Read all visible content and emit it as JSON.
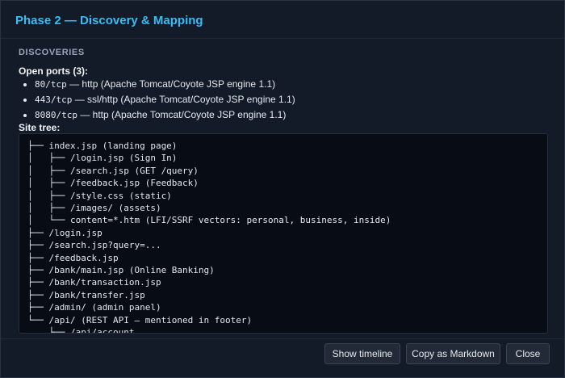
{
  "dialog": {
    "title": "Phase 2 — Discovery & Mapping"
  },
  "discoveries": {
    "section_label": "DISCOVERIES",
    "open_ports_heading": "Open ports (3):",
    "ports": [
      {
        "port": "80/tcp",
        "desc": " — http (Apache Tomcat/Coyote JSP engine 1.1)"
      },
      {
        "port": "443/tcp",
        "desc": " — ssl/http (Apache Tomcat/Coyote JSP engine 1.1)"
      },
      {
        "port": "8080/tcp",
        "desc": " — http (Apache Tomcat/Coyote JSP engine 1.1)"
      }
    ],
    "site_tree_heading": "Site tree:",
    "site_tree_lines": [
      "├── index.jsp (landing page)",
      "│   ├── /login.jsp (Sign In)",
      "│   ├── /search.jsp (GET /query)",
      "│   ├── /feedback.jsp (Feedback)",
      "│   ├── /style.css (static)",
      "│   ├── /images/ (assets)",
      "│   └── content=*.htm (LFI/SSRF vectors: personal, business, inside)",
      "├── /login.jsp",
      "├── /search.jsp?query=...",
      "├── /feedback.jsp",
      "├── /bank/main.jsp (Online Banking)",
      "├── /bank/transaction.jsp",
      "├── /bank/transfer.jsp",
      "├── /admin/ (admin panel)",
      "└── /api/ (REST API — mentioned in footer)",
      "    ├── /api/account"
    ]
  },
  "footer": {
    "show_timeline_label": "Show timeline",
    "copy_markdown_label": "Copy as Markdown",
    "close_label": "Close"
  },
  "colors": {
    "accent": "#38bdf8",
    "background": "#131a28",
    "tree_background": "#080c14"
  }
}
